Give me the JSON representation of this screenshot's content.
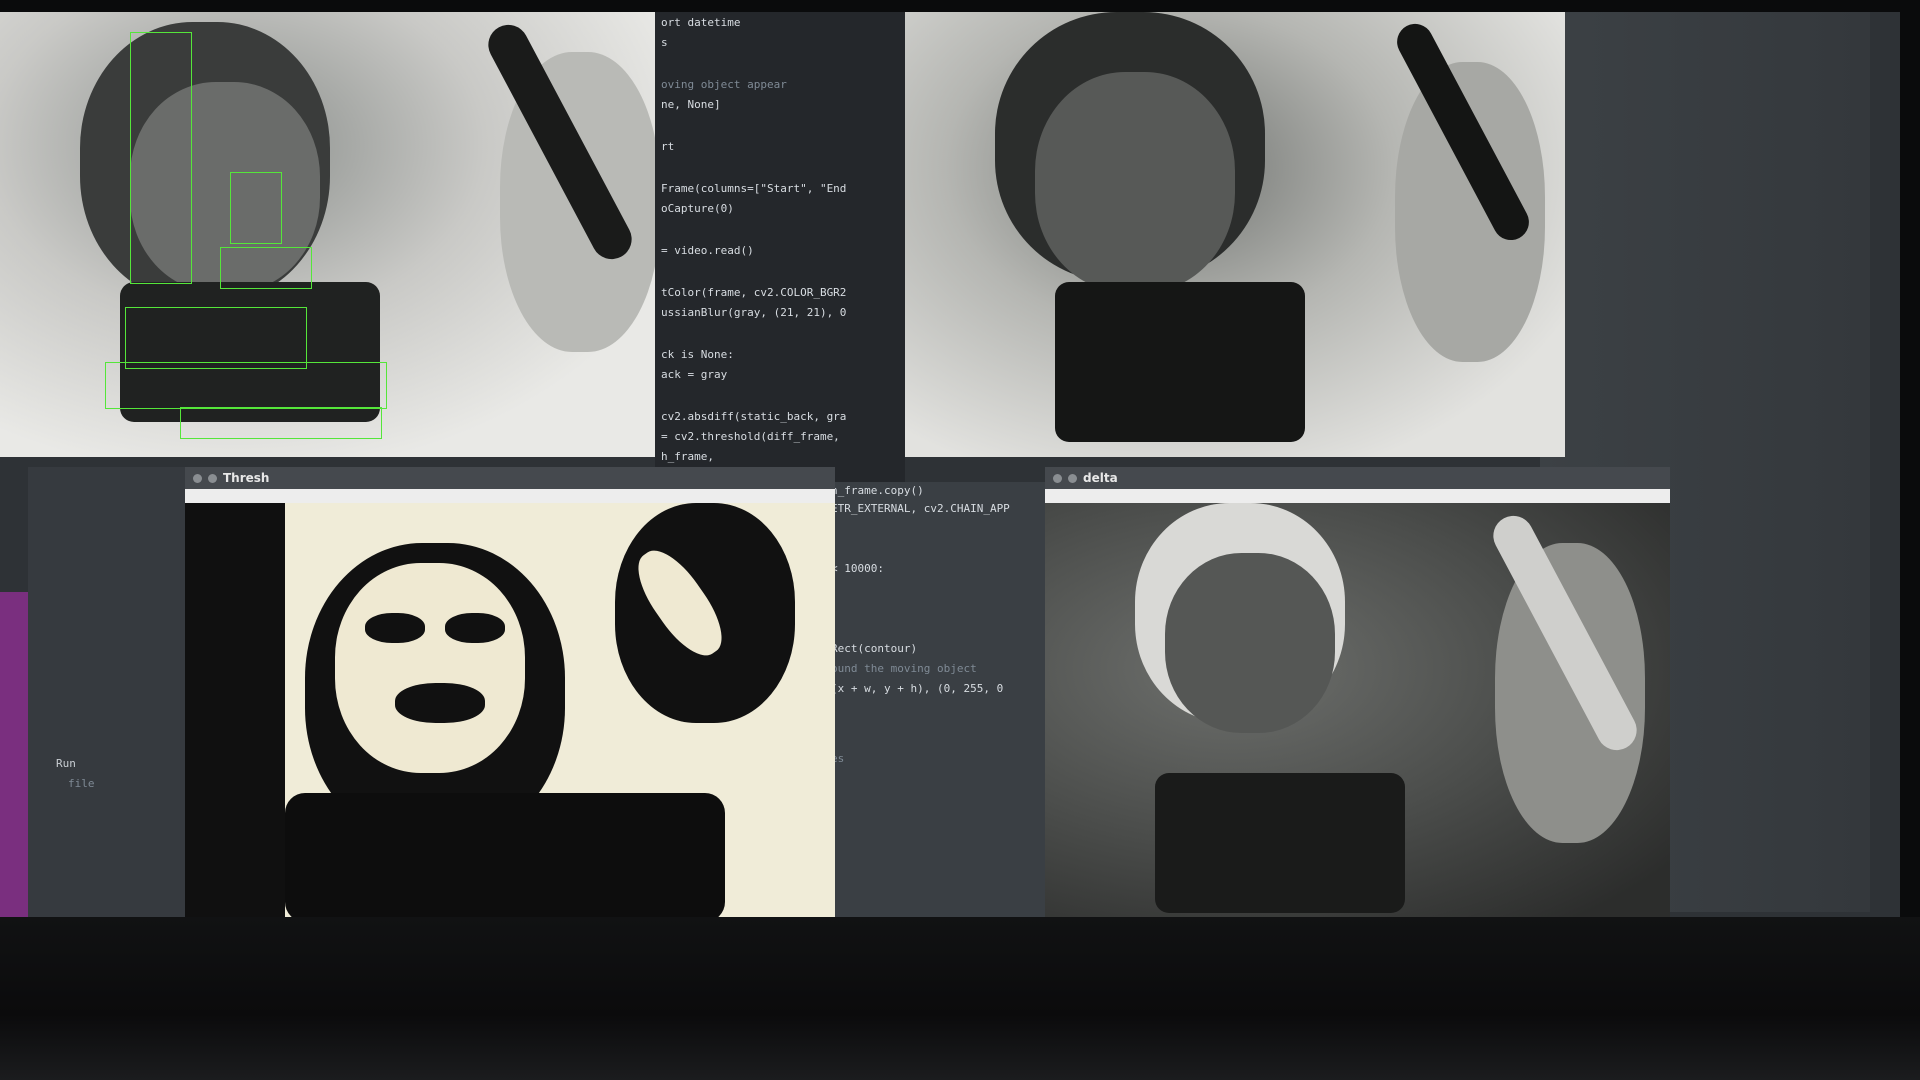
{
  "windows": {
    "delta": {
      "title": "delta"
    },
    "thresh": {
      "title": "Thresh"
    }
  },
  "editor": {
    "lines": [
      "ort datetime",
      "s",
      "oving object appear",
      "ne, None]",
      "rt",
      "Frame(columns=[\"Start\", \"End",
      "oCapture(0)",
      "= video.read()",
      "tColor(frame, cv2.COLOR_BGR2",
      "ussianBlur(gray, (21, 21), 0",
      "ck is None:",
      "ack = gray",
      "cv2.absdiff(static_back, gra",
      "= cv2.threshold(diff_frame,",
      "h_frame,",
      "h_frame.copy()",
      "ETR_EXTERNAL, cv2.CHAIN_APP",
      "< 10000:",
      "Rect(contour)",
      "ound the moving object",
      "(x + w, y + h), (0, 255, 0",
      "es"
    ]
  },
  "side_panel": {
    "tab_label": "Run",
    "file_label": "file"
  }
}
